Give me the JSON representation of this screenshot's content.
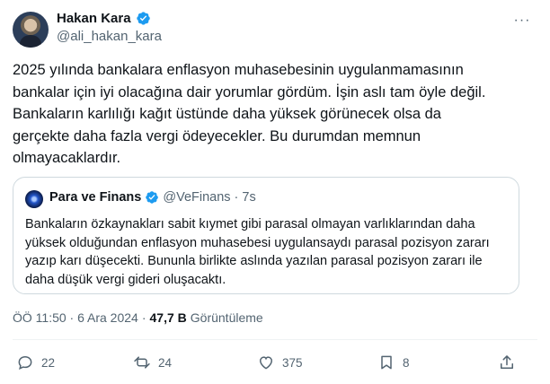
{
  "tweet": {
    "author_name": "Hakan Kara",
    "author_handle": "@ali_hakan_kara",
    "more_label": "···",
    "text": "2025 yılında bankalara enflasyon muhasebesinin uygulanmamasının\nbankalar için iyi olacağına dair yorumlar gördüm. İşin aslı tam öyle değil.\nBankaların karlılığı kağıt üstünde daha yüksek görünecek olsa da\ngerçekte daha fazla vergi ödeyecekler. Bu durumdan memnun\nolmayacaklardır.",
    "timestamp": "ÖÖ 11:50 · 6 Ara 2024",
    "separator": "·",
    "views_count": "47,7 B",
    "views_label": "Görüntüleme"
  },
  "quote": {
    "author_name": "Para ve Finans",
    "author_handle": "@VeFinans",
    "separator": "·",
    "time": "7s",
    "text": "Bankaların özkaynakları sabit kıymet gibi parasal olmayan varlıklarından daha yüksek olduğundan enflasyon muhasebesi uygulansaydı parasal pozisyon zararı yazıp karı düşecekti. Bununla birlikte aslında yazılan parasal pozisyon zararı ile daha düşük vergi gideri oluşacaktı."
  },
  "actions": {
    "replies": "22",
    "reposts": "24",
    "likes": "375",
    "bookmarks": "8"
  },
  "colors": {
    "verified": "#1d9bf0",
    "text": "#0f1419",
    "secondary": "#536471",
    "border": "#cfd9de"
  },
  "icons": [
    "verified-badge-icon",
    "more-icon",
    "reply-icon",
    "repost-icon",
    "like-icon",
    "bookmark-icon",
    "share-icon"
  ]
}
